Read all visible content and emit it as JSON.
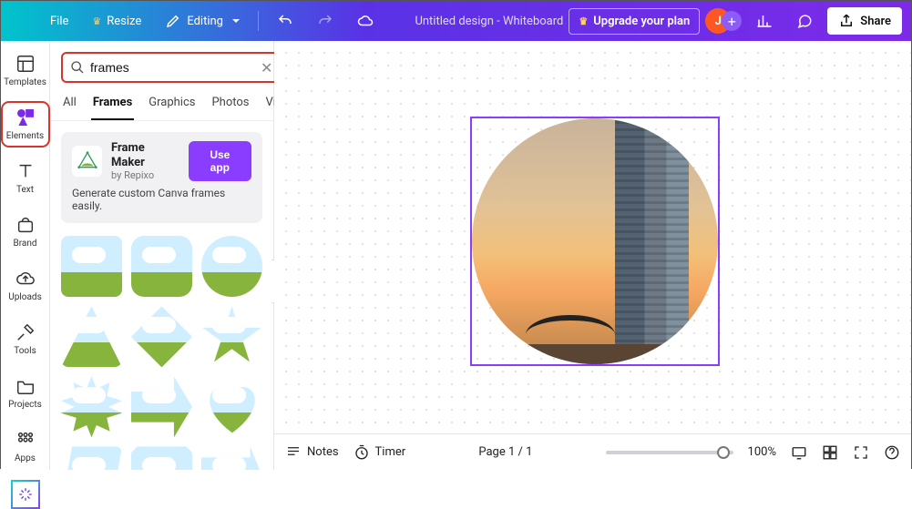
{
  "header": {
    "file": "File",
    "resize": "Resize",
    "editing": "Editing",
    "doc_title": "Untitled design - Whiteboard",
    "upgrade": "Upgrade your plan",
    "avatar_initial": "J",
    "share": "Share"
  },
  "rail": {
    "templates": "Templates",
    "elements": "Elements",
    "text": "Text",
    "brand": "Brand",
    "uploads": "Uploads",
    "tools": "Tools",
    "projects": "Projects",
    "apps": "Apps"
  },
  "panel": {
    "search_value": "frames",
    "tabs": {
      "all": "All",
      "frames": "Frames",
      "graphics": "Graphics",
      "photos": "Photos",
      "videos": "Videos"
    },
    "app_card": {
      "title": "Frame Maker",
      "by_prefix": "by ",
      "by_name": "Repixo",
      "use": "Use app",
      "desc": "Generate custom Canva frames easily."
    }
  },
  "footer": {
    "notes": "Notes",
    "timer": "Timer",
    "page_info": "Page 1 / 1",
    "zoom": "100%"
  },
  "colors": {
    "accent": "#8b3dff",
    "highlight_box": "#d9342b"
  }
}
